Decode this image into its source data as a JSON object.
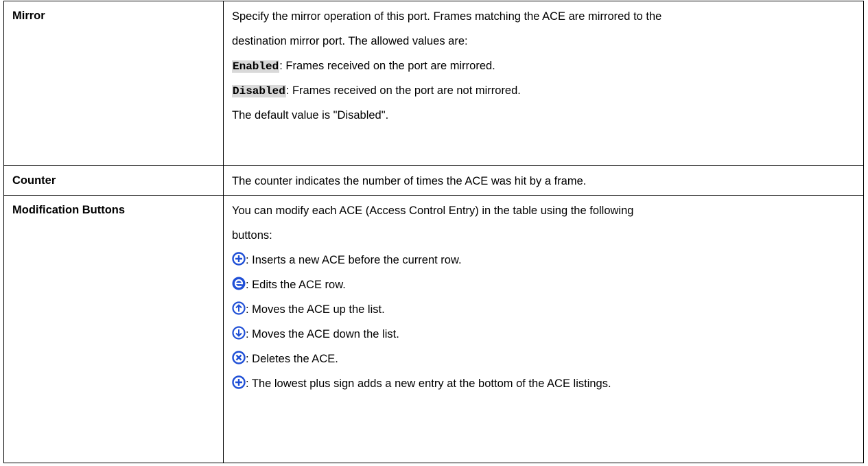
{
  "rows": {
    "mirror": {
      "label": "Mirror",
      "line1": "Specify the mirror operation of this port. Frames matching the ACE are mirrored to the",
      "line2": "destination mirror port. The allowed values are:",
      "enabled_code": "Enabled",
      "enabled_text": ": Frames received on the port are mirrored.",
      "disabled_code": "Disabled",
      "disabled_text": ": Frames received on the port are not mirrored.",
      "default_text": "The default value is \"Disabled\"."
    },
    "counter": {
      "label": "Counter",
      "text": "The counter indicates the number of times the ACE was hit by a frame."
    },
    "modification": {
      "label": "Modification Buttons",
      "line1": "You can modify each ACE (Access Control Entry) in the table using the following",
      "line2": "buttons:",
      "items": [
        {
          "icon": "plus-icon",
          "text": ": Inserts a new ACE before the current row."
        },
        {
          "icon": "edit-icon",
          "text": ": Edits the ACE row."
        },
        {
          "icon": "up-arrow-icon",
          "text": ": Moves the ACE up the list."
        },
        {
          "icon": "down-arrow-icon",
          "text": ": Moves the ACE down the list."
        },
        {
          "icon": "delete-icon",
          "text": ": Deletes the ACE."
        },
        {
          "icon": "plus-icon",
          "text": ": The lowest plus sign adds a new entry at the bottom of the ACE listings."
        }
      ]
    }
  },
  "colors": {
    "icon_blue": "#1f4fd6",
    "code_background": "#d9d9d9",
    "border": "#000000"
  }
}
